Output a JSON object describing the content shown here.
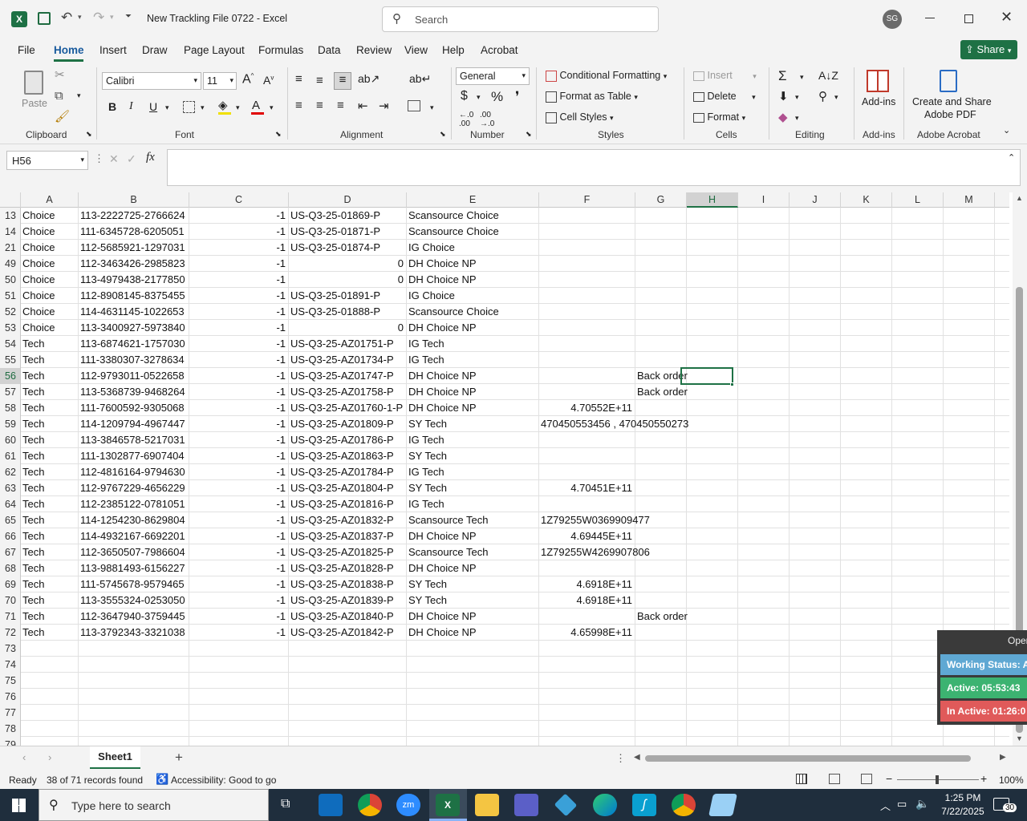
{
  "window": {
    "title": "New Trackling File 0722  -  Excel",
    "search_placeholder": "Search",
    "user_initials": "SG"
  },
  "menu": [
    "File",
    "Home",
    "Insert",
    "Draw",
    "Page Layout",
    "Formulas",
    "Data",
    "Review",
    "View",
    "Help",
    "Acrobat"
  ],
  "share_label": "Share",
  "ribbon": {
    "paste": "Paste",
    "font_name": "Calibri",
    "font_size": "11",
    "number_format": "General",
    "conditional_formatting": "Conditional Formatting",
    "format_as_table": "Format as Table",
    "cell_styles": "Cell Styles",
    "insert": "Insert",
    "delete": "Delete",
    "format": "Format",
    "add_ins": "Add-ins",
    "create_share_1": "Create and Share",
    "create_share_2": "Adobe PDF",
    "groups": [
      "Clipboard",
      "Font",
      "Alignment",
      "Number",
      "Styles",
      "Cells",
      "Editing",
      "Add-ins",
      "Adobe Acrobat"
    ]
  },
  "name_box": "H56",
  "columns": [
    "A",
    "B",
    "C",
    "D",
    "E",
    "F",
    "G",
    "H",
    "I",
    "J",
    "K",
    "L",
    "M"
  ],
  "rows": [
    {
      "n": "13",
      "a": "Choice",
      "b": "113-2222725-2766624",
      "c": "-1",
      "d": "US-Q3-25-01869-P",
      "e": "Scansource Choice",
      "f": "",
      "g": ""
    },
    {
      "n": "14",
      "a": "Choice",
      "b": "111-6345728-6205051",
      "c": "-1",
      "d": "US-Q3-25-01871-P",
      "e": "Scansource Choice",
      "f": "",
      "g": ""
    },
    {
      "n": "21",
      "a": "Choice",
      "b": "112-5685921-1297031",
      "c": "-1",
      "d": "US-Q3-25-01874-P",
      "e": "IG Choice",
      "f": "",
      "g": ""
    },
    {
      "n": "49",
      "a": "Choice",
      "b": "112-3463426-2985823",
      "c": "-1",
      "d": "0",
      "e": "DH Choice NP",
      "f": "",
      "g": ""
    },
    {
      "n": "50",
      "a": "Choice",
      "b": "113-4979438-2177850",
      "c": "-1",
      "d": "0",
      "e": "DH Choice NP",
      "f": "",
      "g": ""
    },
    {
      "n": "51",
      "a": "Choice",
      "b": "112-8908145-8375455",
      "c": "-1",
      "d": "US-Q3-25-01891-P",
      "e": "IG Choice",
      "f": "",
      "g": ""
    },
    {
      "n": "52",
      "a": "Choice",
      "b": "114-4631145-1022653",
      "c": "-1",
      "d": "US-Q3-25-01888-P",
      "e": "Scansource Choice",
      "f": "",
      "g": ""
    },
    {
      "n": "53",
      "a": "Choice",
      "b": "113-3400927-5973840",
      "c": "-1",
      "d": "0",
      "e": "DH Choice NP",
      "f": "",
      "g": ""
    },
    {
      "n": "54",
      "a": "Tech",
      "b": "113-6874621-1757030",
      "c": "-1",
      "d": "US-Q3-25-AZ01751-P",
      "e": "IG Tech",
      "f": "",
      "g": ""
    },
    {
      "n": "55",
      "a": "Tech",
      "b": "111-3380307-3278634",
      "c": "-1",
      "d": "US-Q3-25-AZ01734-P",
      "e": "IG Tech",
      "f": "",
      "g": ""
    },
    {
      "n": "56",
      "a": "Tech",
      "b": "112-9793011-0522658",
      "c": "-1",
      "d": "US-Q3-25-AZ01747-P",
      "e": "DH Choice NP",
      "f": "",
      "g": "Back order"
    },
    {
      "n": "57",
      "a": "Tech",
      "b": "113-5368739-9468264",
      "c": "-1",
      "d": "US-Q3-25-AZ01758-P",
      "e": "DH Choice NP",
      "f": "",
      "g": "Back order"
    },
    {
      "n": "58",
      "a": "Tech",
      "b": "111-7600592-9305068",
      "c": "-1",
      "d": "US-Q3-25-AZ01760-1-P",
      "e": "DH Choice NP",
      "f": "4.70552E+11",
      "g": ""
    },
    {
      "n": "59",
      "a": "Tech",
      "b": "114-1209794-4967447",
      "c": "-1",
      "d": "US-Q3-25-AZ01809-P",
      "e": "SY Tech",
      "f": "470450553456 , 470450550273",
      "g": ""
    },
    {
      "n": "60",
      "a": "Tech",
      "b": "113-3846578-5217031",
      "c": "-1",
      "d": "US-Q3-25-AZ01786-P",
      "e": "IG Tech",
      "f": "",
      "g": ""
    },
    {
      "n": "61",
      "a": "Tech",
      "b": "111-1302877-6907404",
      "c": "-1",
      "d": "US-Q3-25-AZ01863-P",
      "e": "SY Tech",
      "f": "",
      "g": ""
    },
    {
      "n": "62",
      "a": "Tech",
      "b": "112-4816164-9794630",
      "c": "-1",
      "d": "US-Q3-25-AZ01784-P",
      "e": "IG Tech",
      "f": "",
      "g": ""
    },
    {
      "n": "63",
      "a": "Tech",
      "b": "112-9767229-4656229",
      "c": "-1",
      "d": "US-Q3-25-AZ01804-P",
      "e": "SY Tech",
      "f": "4.70451E+11",
      "g": ""
    },
    {
      "n": "64",
      "a": "Tech",
      "b": "112-2385122-0781051",
      "c": "-1",
      "d": "US-Q3-25-AZ01816-P",
      "e": "IG Tech",
      "f": "",
      "g": ""
    },
    {
      "n": "65",
      "a": "Tech",
      "b": "114-1254230-8629804",
      "c": "-1",
      "d": "US-Q3-25-AZ01832-P",
      "e": "Scansource Tech",
      "f": "1Z79255W0369909477",
      "g": ""
    },
    {
      "n": "66",
      "a": "Tech",
      "b": "114-4932167-6692201",
      "c": "-1",
      "d": "US-Q3-25-AZ01837-P",
      "e": "DH Choice NP",
      "f": "4.69445E+11",
      "g": ""
    },
    {
      "n": "67",
      "a": "Tech",
      "b": "112-3650507-7986604",
      "c": "-1",
      "d": "US-Q3-25-AZ01825-P",
      "e": "Scansource Tech",
      "f": "1Z79255W4269907806",
      "g": ""
    },
    {
      "n": "68",
      "a": "Tech",
      "b": "113-9881493-6156227",
      "c": "-1",
      "d": "US-Q3-25-AZ01828-P",
      "e": "DH Choice NP",
      "f": "",
      "g": ""
    },
    {
      "n": "69",
      "a": "Tech",
      "b": "111-5745678-9579465",
      "c": "-1",
      "d": "US-Q3-25-AZ01838-P",
      "e": "SY Tech",
      "f": "4.6918E+11",
      "g": ""
    },
    {
      "n": "70",
      "a": "Tech",
      "b": "113-3555324-0253050",
      "c": "-1",
      "d": "US-Q3-25-AZ01839-P",
      "e": "SY Tech",
      "f": "4.6918E+11",
      "g": ""
    },
    {
      "n": "71",
      "a": "Tech",
      "b": "112-3647940-3759445",
      "c": "-1",
      "d": "US-Q3-25-AZ01840-P",
      "e": "DH Choice NP",
      "f": "",
      "g": "Back order"
    },
    {
      "n": "72",
      "a": "Tech",
      "b": "113-3792343-3321038",
      "c": "-1",
      "d": "US-Q3-25-AZ01842-P",
      "e": "DH Choice NP",
      "f": "4.65998E+11",
      "g": ""
    },
    {
      "n": "73",
      "a": "",
      "b": "",
      "c": "",
      "d": "",
      "e": "",
      "f": "",
      "g": ""
    },
    {
      "n": "74",
      "a": "",
      "b": "",
      "c": "",
      "d": "",
      "e": "",
      "f": "",
      "g": ""
    },
    {
      "n": "75",
      "a": "",
      "b": "",
      "c": "",
      "d": "",
      "e": "",
      "f": "",
      "g": ""
    },
    {
      "n": "76",
      "a": "",
      "b": "",
      "c": "",
      "d": "",
      "e": "",
      "f": "",
      "g": ""
    },
    {
      "n": "77",
      "a": "",
      "b": "",
      "c": "",
      "d": "",
      "e": "",
      "f": "",
      "g": ""
    },
    {
      "n": "78",
      "a": "",
      "b": "",
      "c": "",
      "d": "",
      "e": "",
      "f": "",
      "g": ""
    },
    {
      "n": "79",
      "a": "",
      "b": "",
      "c": "",
      "d": "",
      "e": "",
      "f": "",
      "g": ""
    }
  ],
  "sheet_tab": "Sheet1",
  "status": {
    "ready": "Ready",
    "records": "38 of 71 records found",
    "accessibility": "Accessibility: Good to go",
    "zoom": "100%"
  },
  "widget": {
    "header": "Open",
    "working": "Working Status: A",
    "active": "Active: 05:53:43",
    "inactive": "In Active: 01:26:0"
  },
  "taskbar": {
    "search_placeholder": "Type here to search",
    "time": "1:25 PM",
    "date": "7/22/2025",
    "notifications": "30"
  },
  "colors": {
    "excel_green": "#1e7145",
    "share_green": "#1e7145",
    "active_green": "#3cb371",
    "inactive_red": "#e05a5a",
    "working_blue": "#5fa8d3"
  }
}
